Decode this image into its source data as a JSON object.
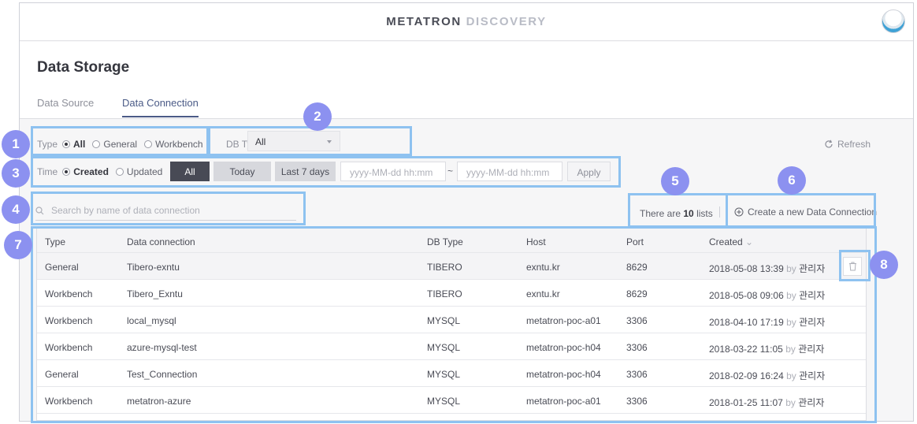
{
  "app": {
    "logo_part1": "METATRON",
    "logo_part2": "DISCOVERY"
  },
  "page": {
    "title": "Data Storage"
  },
  "tabs": [
    {
      "label": "Data Source",
      "active": false
    },
    {
      "label": "Data Connection",
      "active": true
    }
  ],
  "filters": {
    "type_label": "Type",
    "type_options": [
      "All",
      "General",
      "Workbench"
    ],
    "type_selected": "All",
    "db_type_label": "DB Type",
    "db_type_value": "All",
    "time_label": "Time",
    "time_options": [
      "Created",
      "Updated"
    ],
    "time_selected": "Created",
    "time_buttons": [
      "All",
      "Today",
      "Last 7 days"
    ],
    "date_from_placeholder": "yyyy-MM-dd hh:mm",
    "date_to_placeholder": "yyyy-MM-dd hh:mm",
    "date_separator": "~",
    "apply_label": "Apply"
  },
  "toolbar": {
    "refresh_label": "Refresh",
    "search_placeholder": "Search by name of data connection",
    "count_prefix": "There are",
    "count_value": "10",
    "count_suffix": "lists",
    "create_label": "Create a new Data Connection"
  },
  "table": {
    "columns": [
      "Type",
      "Data connection",
      "DB Type",
      "Host",
      "Port",
      "Created"
    ],
    "sort_indicator": "⌄",
    "rows": [
      {
        "type": "General",
        "name": "Tibero-exntu",
        "db_type": "TIBERO",
        "host": "exntu.kr",
        "port": "8629",
        "created": "2018-05-08 13:39",
        "by": "by",
        "user": "관리자"
      },
      {
        "type": "Workbench",
        "name": "Tibero_Exntu",
        "db_type": "TIBERO",
        "host": "exntu.kr",
        "port": "8629",
        "created": "2018-05-08 09:06",
        "by": "by",
        "user": "관리자"
      },
      {
        "type": "Workbench",
        "name": "local_mysql",
        "db_type": "MYSQL",
        "host": "metatron-poc-a01",
        "port": "3306",
        "created": "2018-04-10 17:19",
        "by": "by",
        "user": "관리자"
      },
      {
        "type": "Workbench",
        "name": "azure-mysql-test",
        "db_type": "MYSQL",
        "host": "metatron-poc-h04",
        "port": "3306",
        "created": "2018-03-22 11:05",
        "by": "by",
        "user": "관리자"
      },
      {
        "type": "General",
        "name": "Test_Connection",
        "db_type": "MYSQL",
        "host": "metatron-poc-h04",
        "port": "3306",
        "created": "2018-02-09 16:24",
        "by": "by",
        "user": "관리자"
      },
      {
        "type": "Workbench",
        "name": "metatron-azure",
        "db_type": "MYSQL",
        "host": "metatron-poc-a01",
        "port": "3306",
        "created": "2018-01-25 11:07",
        "by": "by",
        "user": "관리자"
      }
    ]
  },
  "annotations": [
    "1",
    "2",
    "3",
    "4",
    "5",
    "6",
    "7",
    "8"
  ],
  "colors": {
    "accent": "#4b5b87",
    "annotation_box": "#8ec2f0",
    "annotation_badge": "#8c91f0",
    "dark_button": "#484a55"
  },
  "icons": {
    "refresh": "refresh-icon",
    "search": "search-icon",
    "create": "plus-circle-icon",
    "delete": "trash-icon",
    "dropdown": "chevron-down-icon",
    "avatar": "user-avatar"
  }
}
